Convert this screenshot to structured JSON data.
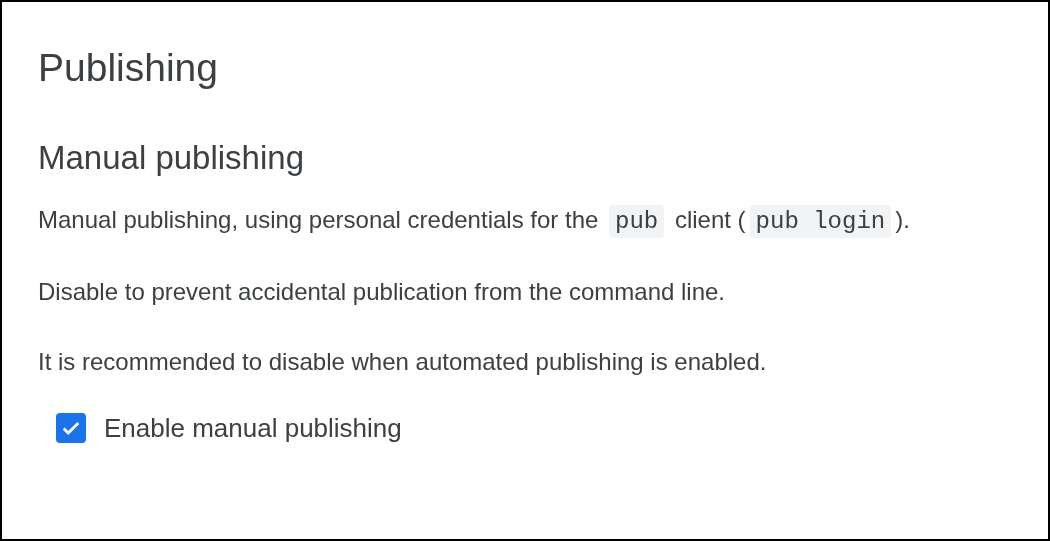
{
  "title": "Publishing",
  "section": {
    "heading": "Manual publishing",
    "paragraphs": [
      [
        {
          "kind": "text",
          "text": "Manual publishing, using personal credentials for the "
        },
        {
          "kind": "code",
          "text": "pub"
        },
        {
          "kind": "text",
          "text": " client ("
        },
        {
          "kind": "code",
          "text": "pub login"
        },
        {
          "kind": "text",
          "text": ")."
        }
      ],
      [
        {
          "kind": "text",
          "text": "Disable to prevent accidental publication from the command line."
        }
      ],
      [
        {
          "kind": "text",
          "text": "It is recommended to disable when automated publishing is enabled."
        }
      ]
    ],
    "checkbox": {
      "label": "Enable manual publishing",
      "checked": true
    }
  }
}
